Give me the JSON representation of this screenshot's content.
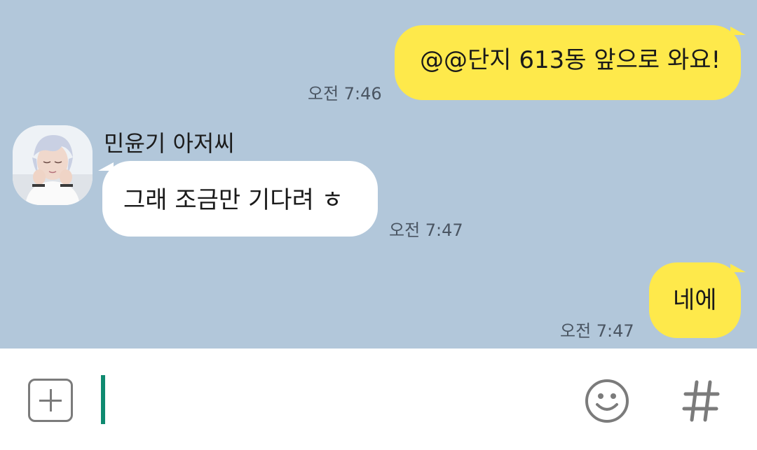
{
  "messages": [
    {
      "direction": "out",
      "text": "@@단지 613동 앞으로 와요!",
      "time": "오전 7:46"
    },
    {
      "direction": "in",
      "sender": "민윤기 아저씨",
      "text": "그래 조금만 기다려 ㅎ",
      "time": "오전 7:47"
    },
    {
      "direction": "out",
      "text": "네에",
      "time": "오전 7:47"
    }
  ],
  "input": {
    "value": "",
    "cursor_color": "#0f8a70"
  },
  "icons": {
    "attach": "plus-icon",
    "emoji": "smiley-icon",
    "hashtag": "hash-icon"
  },
  "colors": {
    "chat_background": "#b2c7da",
    "outgoing_bubble": "#fee94b",
    "incoming_bubble": "#ffffff"
  }
}
